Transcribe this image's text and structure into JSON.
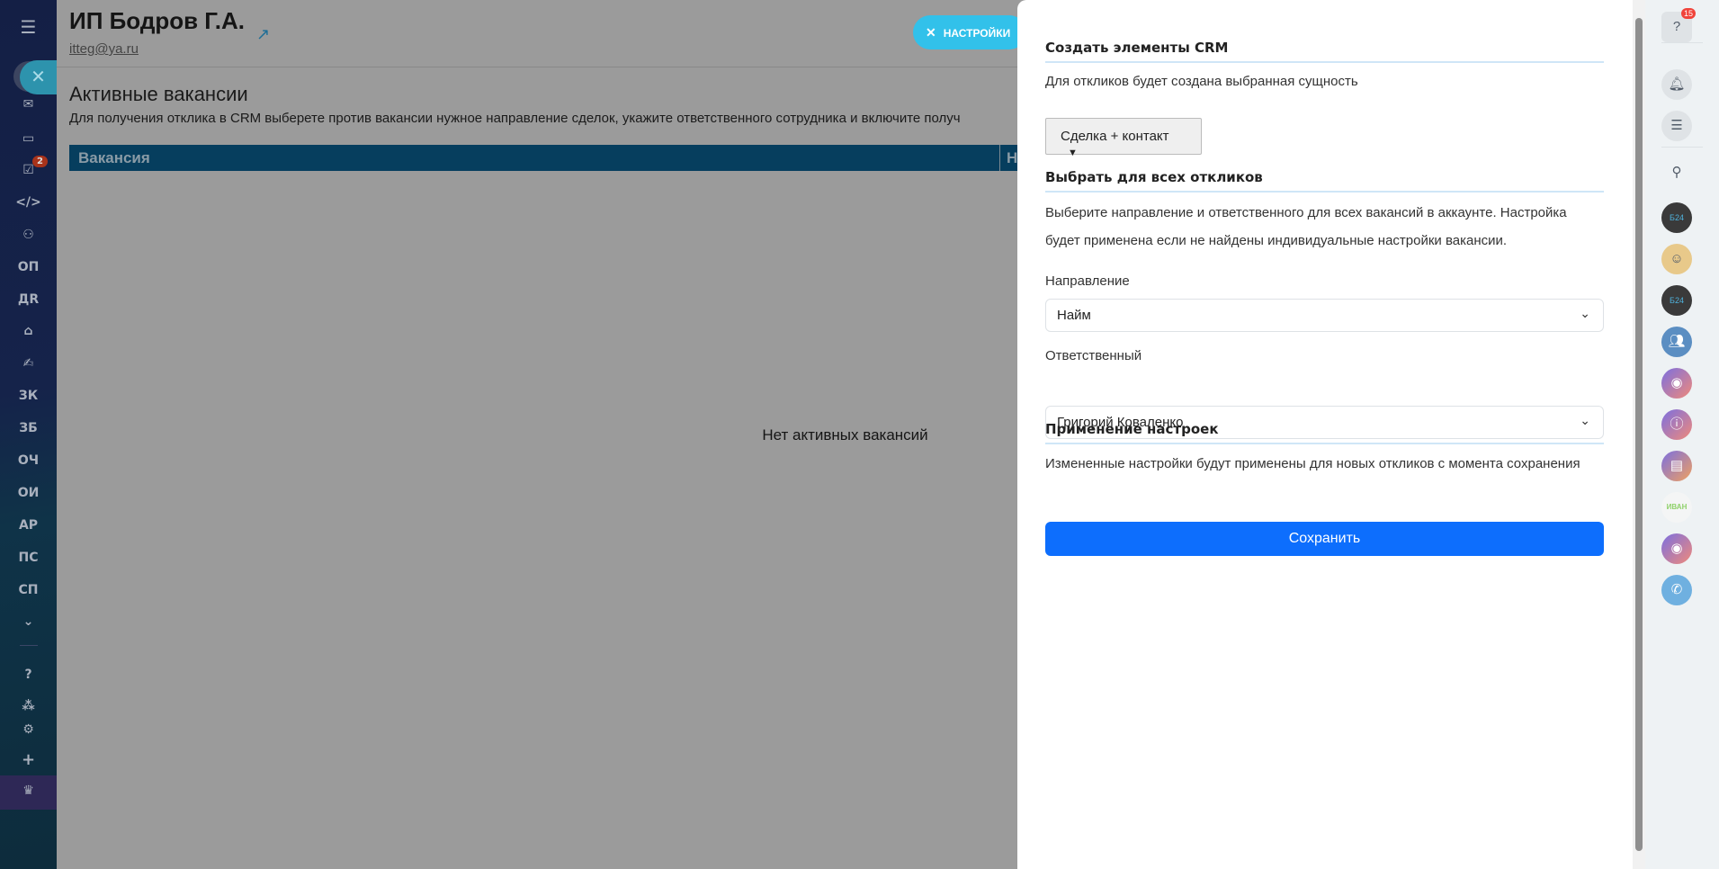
{
  "left_sidebar": {
    "task_badge": "2",
    "items": [
      "ОП",
      "ДR",
      "ЗК",
      "ЗБ",
      "ОЧ",
      "ОИ",
      "АР",
      "ПС",
      "СП"
    ]
  },
  "header": {
    "title": "ИП Бодров Г.А.",
    "email": "itteg@ya.ru",
    "settings_button": "НАСТРОЙКИ"
  },
  "main": {
    "section_title": "Активные вакансии",
    "description": "Для получения отклика в CRM выберете против вакансии нужное направление сделок, укажите ответственного сотрудника и включите получ",
    "table_headers": [
      "Вакансия",
      "Н"
    ],
    "empty_text": "Нет активных вакансий"
  },
  "panel": {
    "s1_title": "Создать элементы CRM",
    "s1_text": "Для откликов будет создана выбранная сущность",
    "entity_select": "Сделка + контакт",
    "s2_title": "Выбрать для всех откликов",
    "s2_text": "Выберите направление и ответственного для всех вакансий в аккаунте. Настройка будет применена если не найдены индивидуальные настройки вакансии.",
    "direction_label": "Направление",
    "direction_value": "Найм",
    "responsible_label": "Ответственный",
    "responsible_value": "Григорий Коваленко",
    "s3_title": "Применение настроек",
    "s3_text": "Измененные настройки будут применены для новых откликов с момента сохранения",
    "save_button": "Сохранить"
  },
  "right_bar": {
    "help_badge": "15",
    "avatar_text": "ИВАН",
    "b24_text": "Б24"
  },
  "colors": {
    "accent": "#0d6efd",
    "settings": "#32c1ea",
    "table_header": "#063e5e"
  }
}
